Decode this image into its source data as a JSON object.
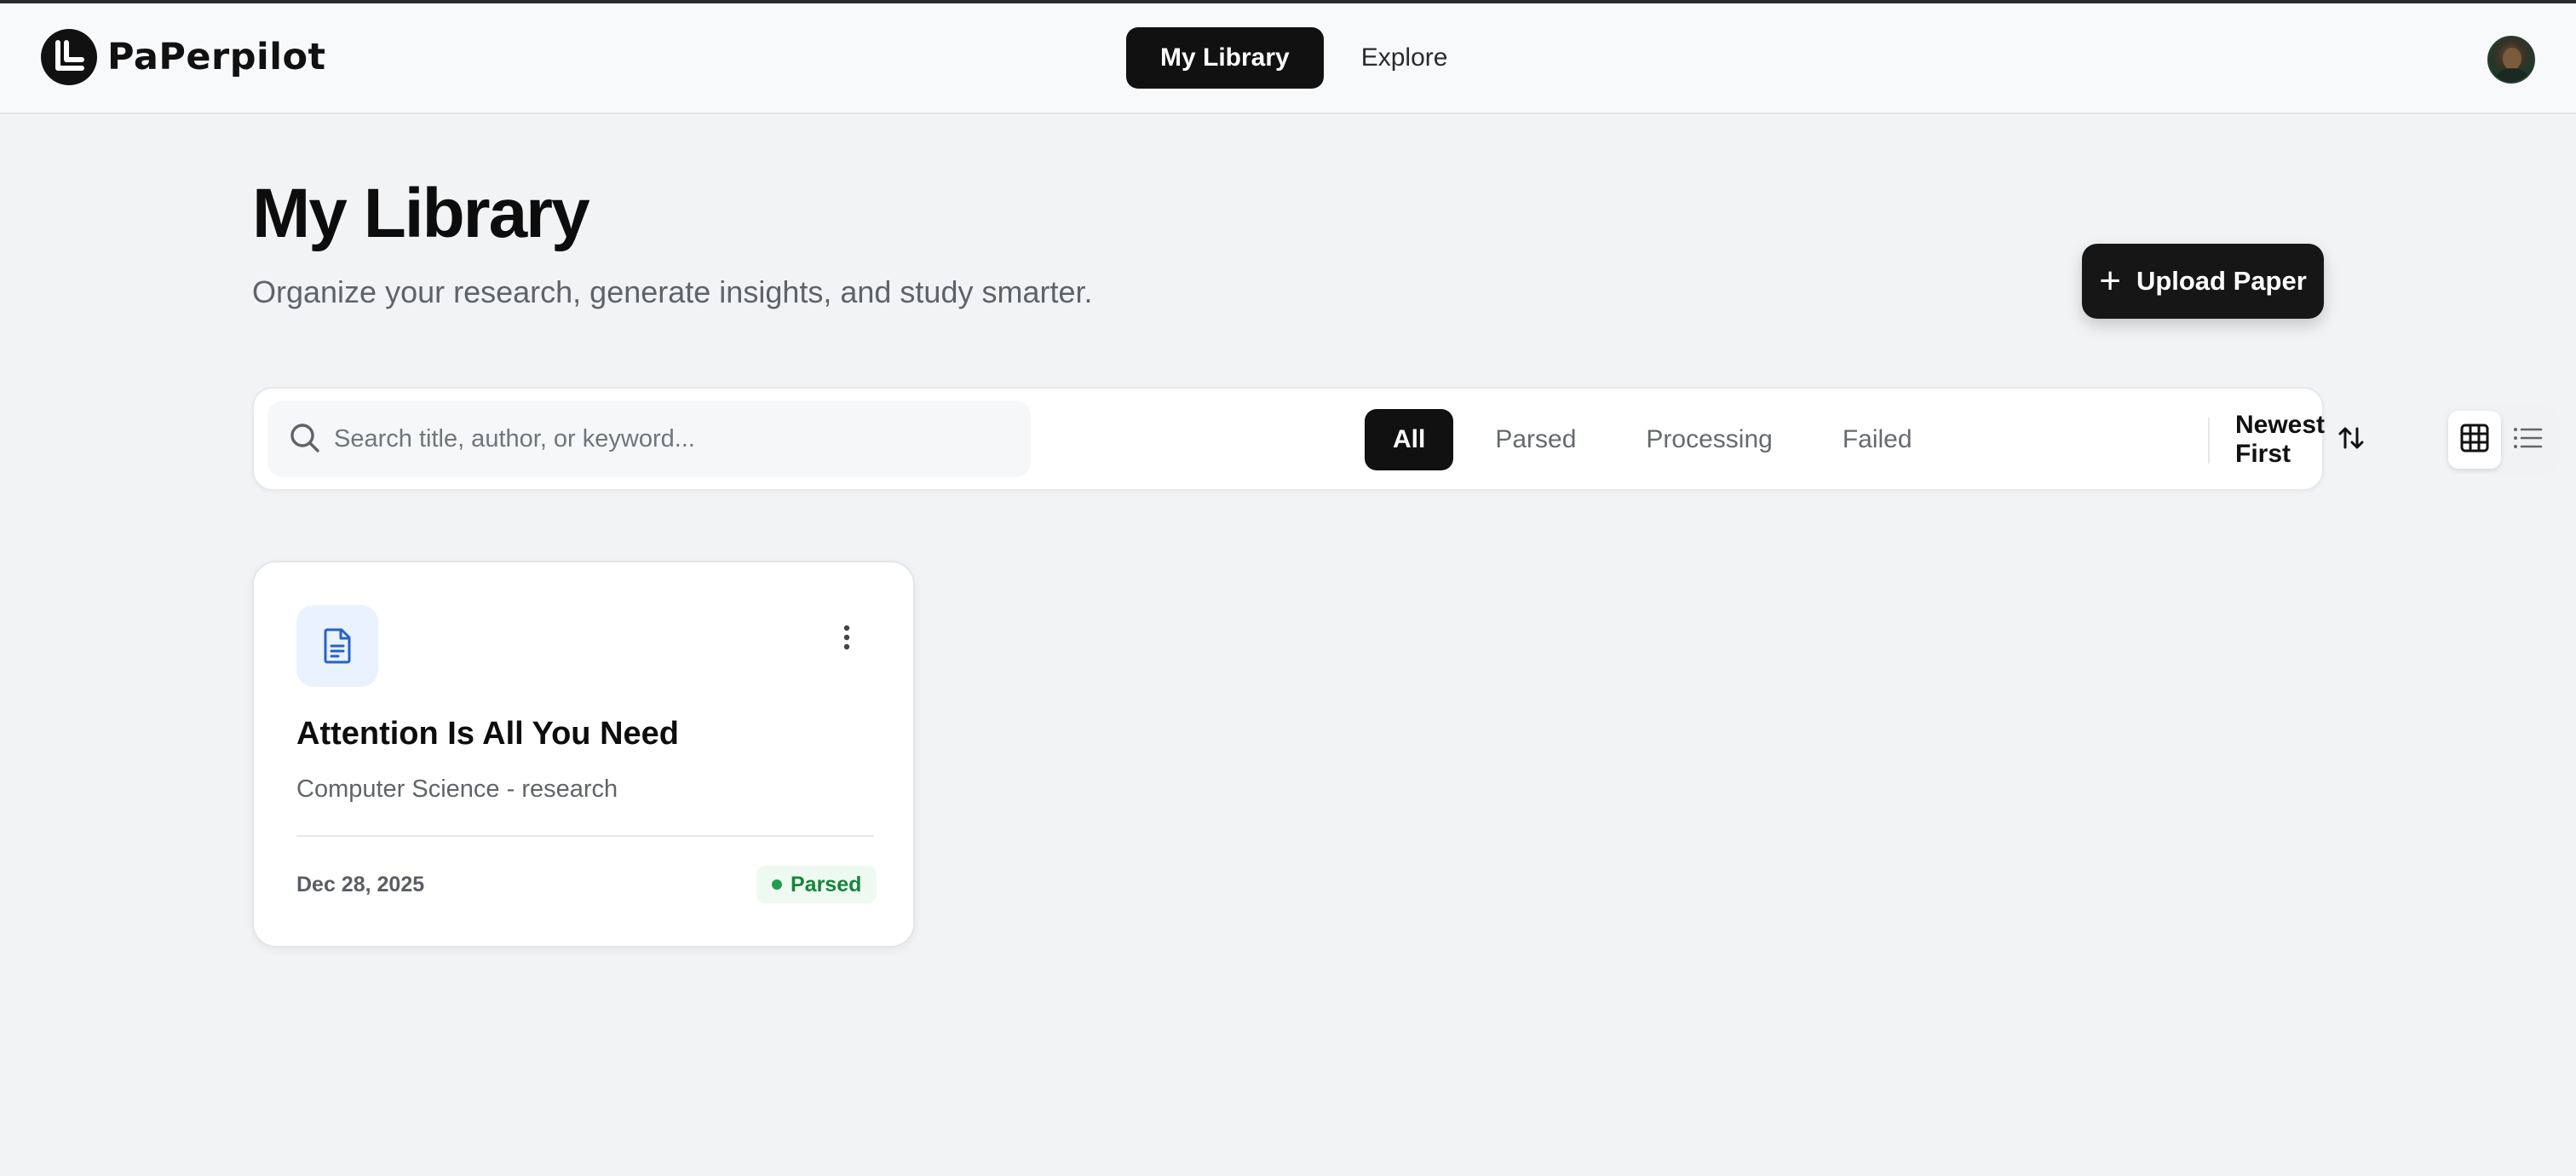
{
  "app": {
    "brand_name": "PaPerpilot"
  },
  "nav": {
    "tabs": [
      {
        "label": "My Library",
        "active": true
      },
      {
        "label": "Explore",
        "active": false
      }
    ]
  },
  "header": {
    "title": "My Library",
    "subtitle": "Organize your research, generate insights, and study smarter.",
    "upload_label": "Upload Paper"
  },
  "toolbar": {
    "search_placeholder": "Search title, author, or keyword...",
    "search_value": "",
    "filters": [
      {
        "label": "All",
        "active": true
      },
      {
        "label": "Parsed",
        "active": false
      },
      {
        "label": "Processing",
        "active": false
      },
      {
        "label": "Failed",
        "active": false
      }
    ],
    "sort_label": "Newest First",
    "view_mode": "grid"
  },
  "papers": [
    {
      "title": "Attention Is All You Need",
      "subtitle": "Computer Science - research",
      "date": "Dec 28, 2025",
      "status": "Parsed"
    }
  ],
  "colors": {
    "accent": "#111111",
    "background": "#f2f3f5",
    "doc_icon": "#2563c9",
    "status_parsed": "#17853e"
  },
  "icons": {
    "brand": "brand-logo-icon",
    "search": "search-icon",
    "sort": "sort-arrows-icon",
    "grid_view": "grid-icon",
    "list_view": "list-icon",
    "paper": "document-icon",
    "menu": "more-vertical-icon",
    "upload": "plus-icon"
  }
}
